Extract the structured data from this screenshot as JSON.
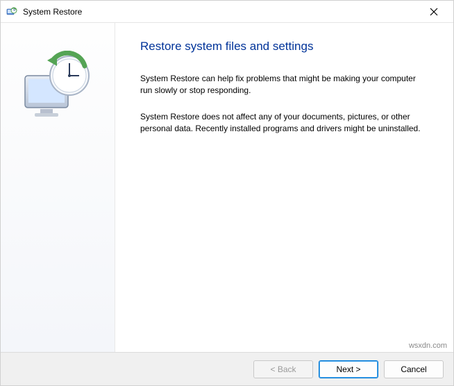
{
  "titlebar": {
    "title": "System Restore"
  },
  "content": {
    "heading": "Restore system files and settings",
    "paragraph1": "System Restore can help fix problems that might be making your computer run slowly or stop responding.",
    "paragraph2": "System Restore does not affect any of your documents, pictures, or other personal data. Recently installed programs and drivers might be uninstalled."
  },
  "buttons": {
    "back": "< Back",
    "next": "Next >",
    "cancel": "Cancel"
  },
  "watermark": "wsxdn.com"
}
